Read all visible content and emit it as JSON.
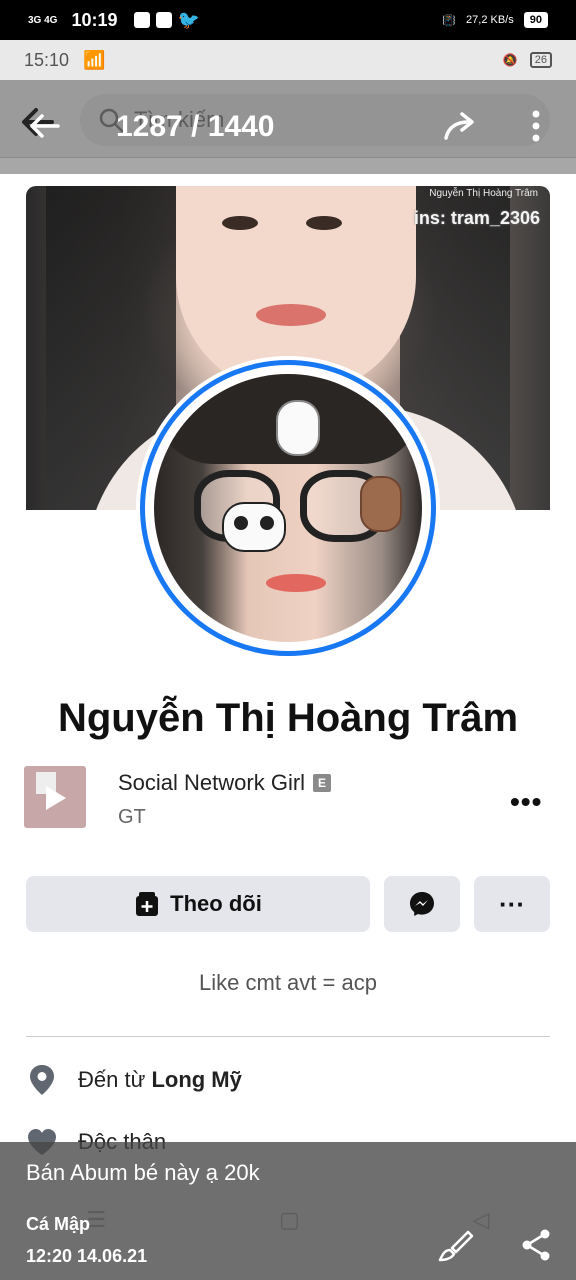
{
  "outer_status": {
    "network": "3G 4G",
    "time": "10:19",
    "data_speed": "27,2 KB/s",
    "battery": "90"
  },
  "inner_status": {
    "time": "15:10",
    "battery": "26"
  },
  "viewer": {
    "counter": "1287 / 1440",
    "caption": "Bán Abum bé này ạ 20k",
    "author": "Cá Mập",
    "timestamp": "12:20 14.06.21"
  },
  "fb_header": {
    "search_placeholder": "Tìm kiếm"
  },
  "cover": {
    "watermark_top": "Nguyễn Thị Hoàng Trâm",
    "watermark_ins": "ins: tram_2306"
  },
  "profile": {
    "name": "Nguyễn Thị Hoàng Trâm",
    "bio": "Like cmt avt = acp",
    "follow_label": "Theo dõi",
    "more_label": "···"
  },
  "music": {
    "title": "Social Network Girl",
    "explicit_badge": "E",
    "artist": "GT"
  },
  "details": {
    "from_prefix": "Đến từ ",
    "from_place": "Long Mỹ",
    "relationship": "Độc thân"
  },
  "colors": {
    "accent": "#1877f2",
    "button_bg": "#e4e6eb"
  }
}
